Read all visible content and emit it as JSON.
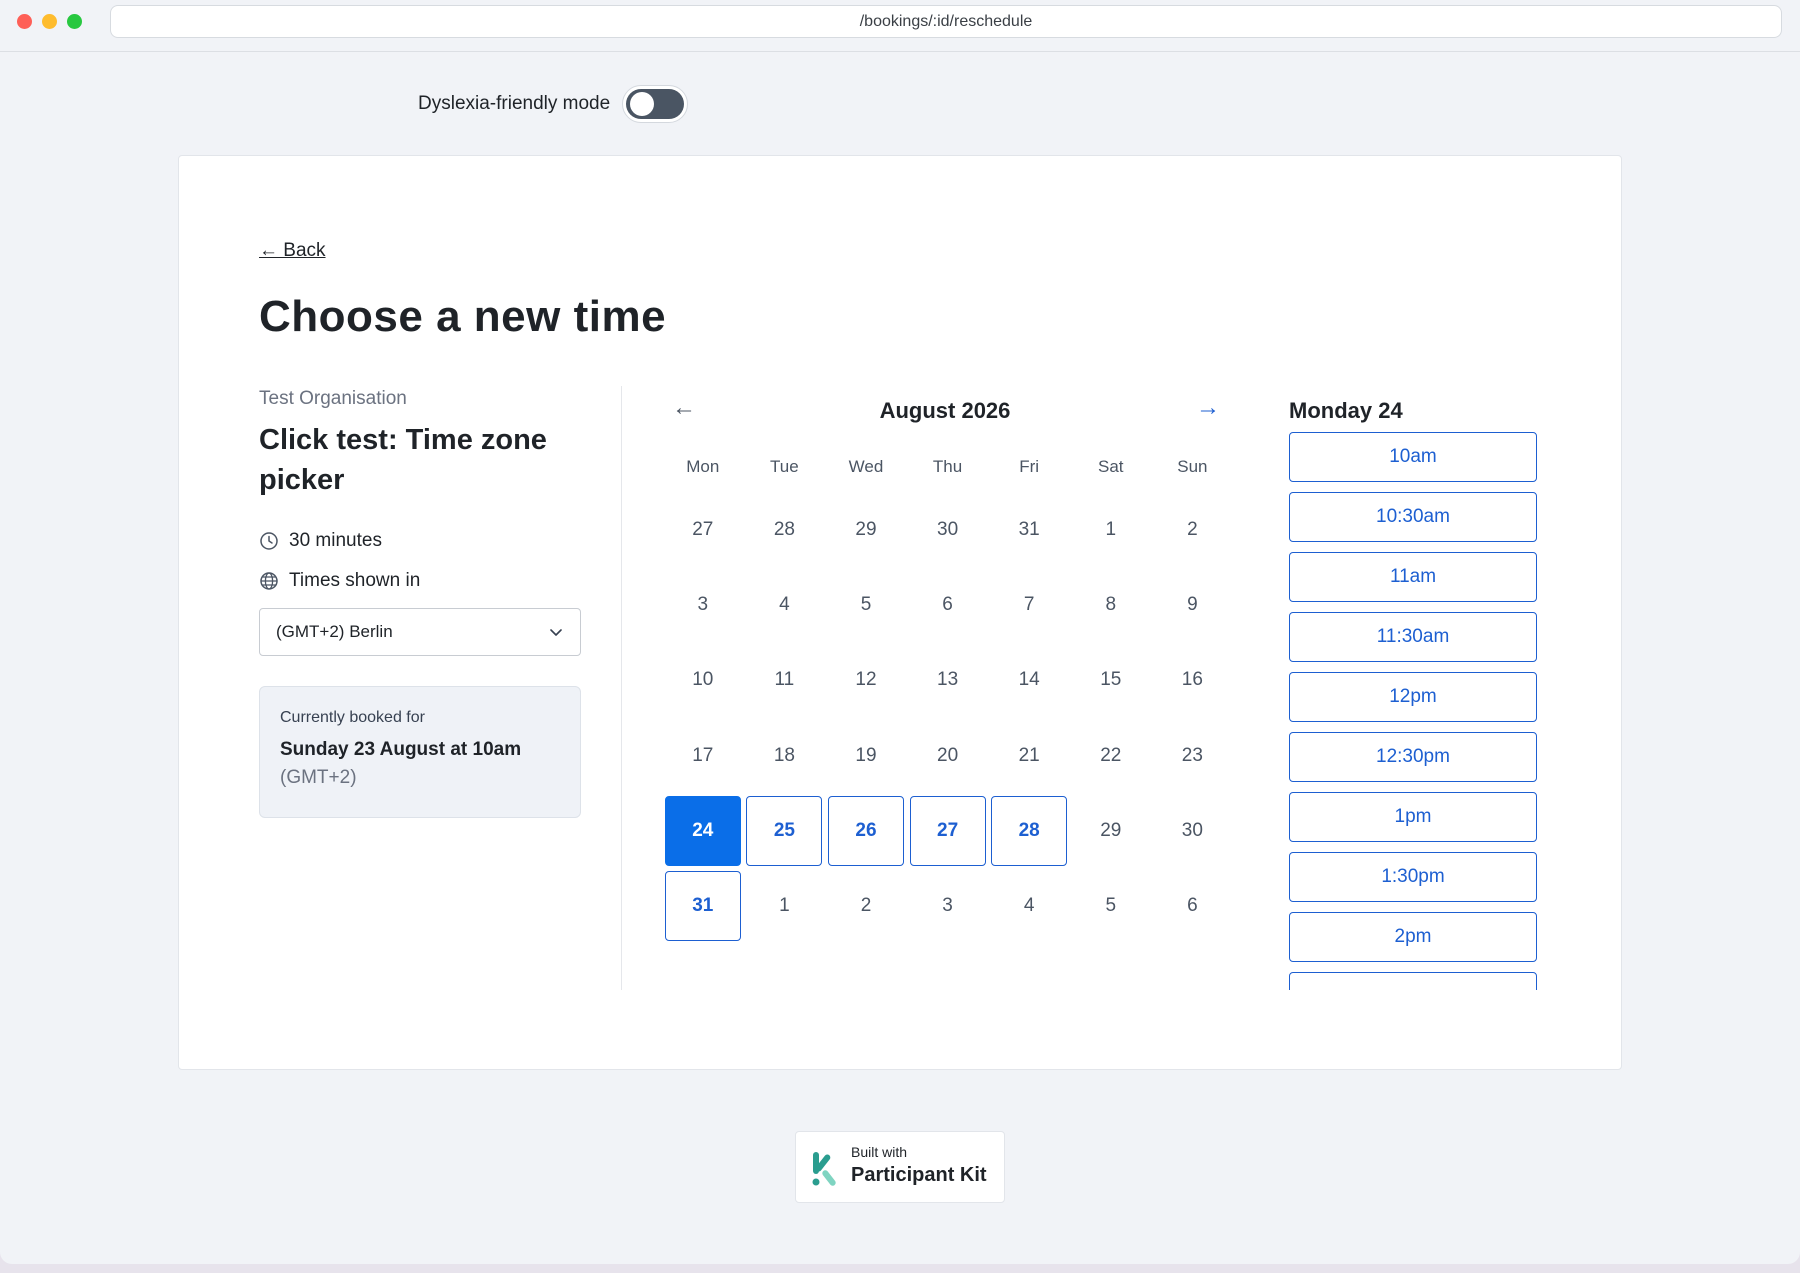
{
  "browser": {
    "url": "/bookings/:id/reschedule"
  },
  "accessibility": {
    "toggle_label": "Dyslexia-friendly mode",
    "toggle_on": false
  },
  "page": {
    "back_label": "← Back",
    "title": "Choose a new time"
  },
  "event": {
    "organisation": "Test Organisation",
    "title": "Click test: Time zone picker",
    "duration": "30 minutes",
    "timezone_label": "Times shown in",
    "timezone_value": "(GMT+2) Berlin",
    "icons": [
      "clock-icon",
      "globe-icon",
      "chevron-down-icon"
    ]
  },
  "current_booking": {
    "label": "Currently booked for",
    "when": "Sunday 23 August at 10am",
    "timezone": "(GMT+2)"
  },
  "calendar": {
    "prev_label": "←",
    "next_label": "→",
    "month": "August 2026",
    "weekdays": [
      "Mon",
      "Tue",
      "Wed",
      "Thu",
      "Fri",
      "Sat",
      "Sun"
    ],
    "days": [
      {
        "label": "27",
        "state": "muted"
      },
      {
        "label": "28",
        "state": "muted"
      },
      {
        "label": "29",
        "state": "muted"
      },
      {
        "label": "30",
        "state": "muted"
      },
      {
        "label": "31",
        "state": "muted"
      },
      {
        "label": "1",
        "state": "muted"
      },
      {
        "label": "2",
        "state": "muted"
      },
      {
        "label": "3",
        "state": "muted"
      },
      {
        "label": "4",
        "state": "muted"
      },
      {
        "label": "5",
        "state": "muted"
      },
      {
        "label": "6",
        "state": "muted"
      },
      {
        "label": "7",
        "state": "muted"
      },
      {
        "label": "8",
        "state": "muted"
      },
      {
        "label": "9",
        "state": "muted"
      },
      {
        "label": "10",
        "state": "muted"
      },
      {
        "label": "11",
        "state": "muted"
      },
      {
        "label": "12",
        "state": "muted"
      },
      {
        "label": "13",
        "state": "muted"
      },
      {
        "label": "14",
        "state": "muted"
      },
      {
        "label": "15",
        "state": "muted"
      },
      {
        "label": "16",
        "state": "muted"
      },
      {
        "label": "17",
        "state": "muted"
      },
      {
        "label": "18",
        "state": "muted"
      },
      {
        "label": "19",
        "state": "muted"
      },
      {
        "label": "20",
        "state": "muted"
      },
      {
        "label": "21",
        "state": "muted"
      },
      {
        "label": "22",
        "state": "muted"
      },
      {
        "label": "23",
        "state": "muted"
      },
      {
        "label": "24",
        "state": "selected"
      },
      {
        "label": "25",
        "state": "available"
      },
      {
        "label": "26",
        "state": "available"
      },
      {
        "label": "27",
        "state": "available"
      },
      {
        "label": "28",
        "state": "available"
      },
      {
        "label": "29",
        "state": "muted"
      },
      {
        "label": "30",
        "state": "muted"
      },
      {
        "label": "31",
        "state": "available"
      },
      {
        "label": "1",
        "state": "muted"
      },
      {
        "label": "2",
        "state": "muted"
      },
      {
        "label": "3",
        "state": "muted"
      },
      {
        "label": "4",
        "state": "muted"
      },
      {
        "label": "5",
        "state": "muted"
      },
      {
        "label": "6",
        "state": "muted"
      }
    ]
  },
  "slots": {
    "title": "Monday 24",
    "times": [
      "10am",
      "10:30am",
      "11am",
      "11:30am",
      "12pm",
      "12:30pm",
      "1pm",
      "1:30pm",
      "2pm",
      ""
    ]
  },
  "footer": {
    "built_with": "Built with",
    "brand": "Participant Kit"
  },
  "colors": {
    "accent": "#1d5fd1",
    "selected": "#0a6ee8",
    "brand_teal": "#2a9d8f"
  }
}
